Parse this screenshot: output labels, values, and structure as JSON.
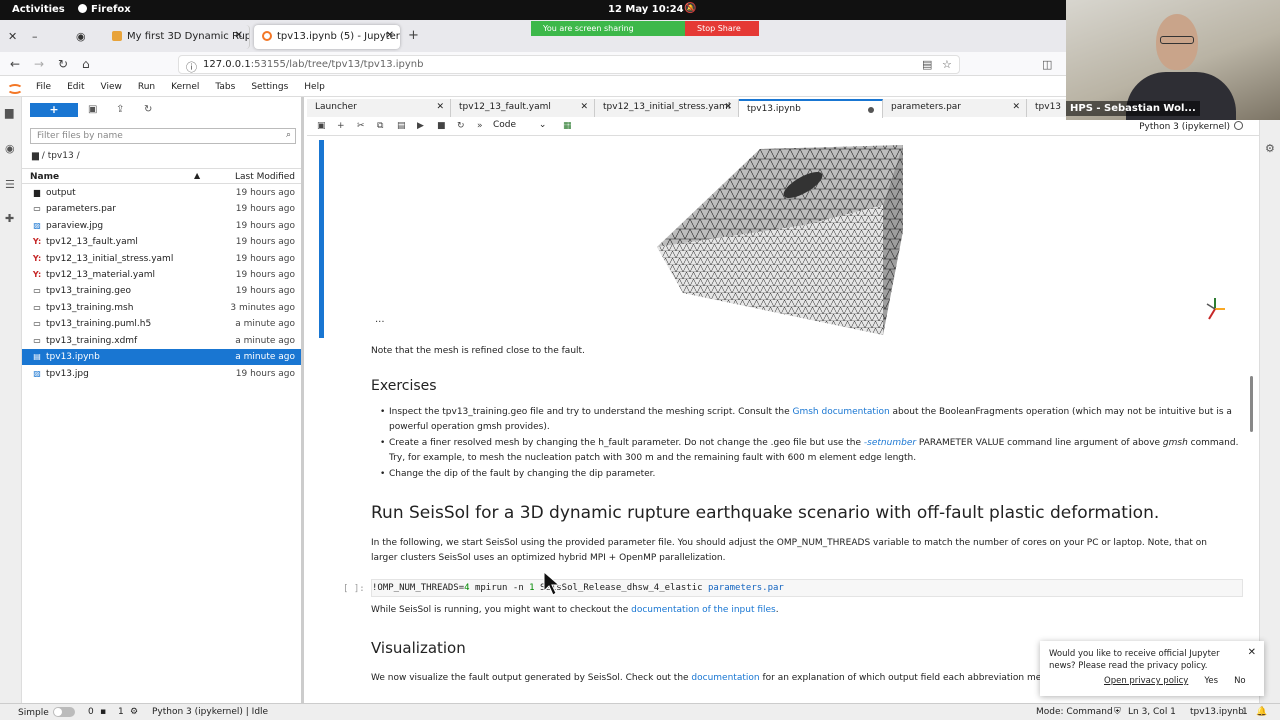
{
  "os_bar": {
    "activities": "Activities",
    "app": "Firefox",
    "datetime": "12 May  10:24"
  },
  "screen_share": {
    "status": "You are screen sharing",
    "stop": "Stop Share"
  },
  "browser": {
    "tabs": [
      {
        "label": "My first 3D Dynamic Rupt",
        "active": false
      },
      {
        "label": "tpv13.ipynb (5) - JupyterL",
        "active": true
      }
    ],
    "url_host": "127.0.0.1",
    "url_path": ":53155/lab/tree/tpv13/tpv13.ipynb"
  },
  "webcam": {
    "label": "HPS - Sebastian Wol..."
  },
  "jupyter_menu": [
    "File",
    "Edit",
    "View",
    "Run",
    "Kernel",
    "Tabs",
    "Settings",
    "Help"
  ],
  "filebrowser": {
    "new_label": "+",
    "filter_placeholder": "Filter files by name",
    "breadcrumb": "/ tpv13 /",
    "col_name": "Name",
    "col_modified": "Last Modified",
    "files": [
      {
        "name": "output",
        "modified": "19 hours ago",
        "icon": "folder-icon"
      },
      {
        "name": "parameters.par",
        "modified": "19 hours ago",
        "icon": "file-icon"
      },
      {
        "name": "paraview.jpg",
        "modified": "19 hours ago",
        "icon": "image-icon"
      },
      {
        "name": "tpv12_13_fault.yaml",
        "modified": "19 hours ago",
        "icon": "yaml-icon"
      },
      {
        "name": "tpv12_13_initial_stress.yaml",
        "modified": "19 hours ago",
        "icon": "yaml-icon"
      },
      {
        "name": "tpv12_13_material.yaml",
        "modified": "19 hours ago",
        "icon": "yaml-icon"
      },
      {
        "name": "tpv13_training.geo",
        "modified": "19 hours ago",
        "icon": "file-icon"
      },
      {
        "name": "tpv13_training.msh",
        "modified": "3 minutes ago",
        "icon": "file-icon"
      },
      {
        "name": "tpv13_training.puml.h5",
        "modified": "a minute ago",
        "icon": "file-icon"
      },
      {
        "name": "tpv13_training.xdmf",
        "modified": "a minute ago",
        "icon": "file-icon"
      },
      {
        "name": "tpv13.ipynb",
        "modified": "a minute ago",
        "icon": "notebook-icon",
        "selected": true
      },
      {
        "name": "tpv13.jpg",
        "modified": "19 hours ago",
        "icon": "image-icon"
      }
    ]
  },
  "doc_tabs": [
    {
      "label": "Launcher"
    },
    {
      "label": "tpv12_13_fault.yaml"
    },
    {
      "label": "tpv12_13_initial_stress.yaml"
    },
    {
      "label": "tpv13.ipynb",
      "active": true
    },
    {
      "label": "parameters.par"
    },
    {
      "label": "tpv13"
    }
  ],
  "notebook_toolbar": {
    "cell_type": "Code",
    "kernel": "Python 3 (ipykernel)"
  },
  "notebook": {
    "collapsed_marker": "···",
    "mesh_note": "Note that the mesh is refined close to the fault.",
    "exercises_title": "Exercises",
    "ex1_a": "Inspect the tpv13_training.geo file and try to understand the meshing script. Consult the ",
    "ex1_link": "Gmsh documentation",
    "ex1_b": " about the BooleanFragments operation (which may not be intuitive but is a powerful operation gmsh provides).",
    "ex2_a": "Create a finer resolved mesh by changing the h_fault parameter. Do not change the .geo file but use the ",
    "ex2_code": "-setnumber",
    "ex2_b": " PARAMETER VALUE command line argument of above ",
    "ex2_em": "gmsh",
    "ex2_c": " command. Try, for example, to mesh the nucleation patch with 300 m and the remaining fault with 600 m element edge length.",
    "ex3": "Change the dip of the fault by changing the dip parameter.",
    "run_title": "Run SeisSol for a 3D dynamic rupture earthquake scenario with off-fault plastic deformation.",
    "run_text": "In the following, we start SeisSol using the provided parameter file. You should adjust the OMP_NUM_THREADS variable to match the number of cores on your PC or laptop. Note, that on larger clusters SeisSol uses an optimized hybrid MPI + OpenMP parallelization.",
    "prompt": "[ ]:",
    "code_a": "!OMP_NUM_THREADS=",
    "code_num": "4",
    "code_b": " mpirun -n ",
    "code_num2": "1",
    "code_c": " SeisSol_Release_dhsw_4_elastic ",
    "code_var": "parameters.par",
    "while_a": "While SeisSol is running, you might want to checkout the ",
    "while_link": "documentation of the input files",
    "while_b": ".",
    "vis_title": "Visualization",
    "vis_a": "We now visualize the fault output generated by SeisSol. Check out the ",
    "vis_link": "documentation",
    "vis_b": " for an explanation of which output field each abbreviation means."
  },
  "notification": {
    "text": "Would you like to receive official Jupyter news? Please read the privacy policy.",
    "privacy": "Open privacy policy",
    "yes": "Yes",
    "no": "No"
  },
  "statusbar": {
    "mode_simple": "Simple",
    "count0": "0",
    "count1": "1",
    "kernel_status": "Python 3 (ipykernel) | Idle",
    "mode": "Mode: Command",
    "position": "Ln 3, Col 1",
    "file": "tpv13.ipynb",
    "count2": "1"
  }
}
